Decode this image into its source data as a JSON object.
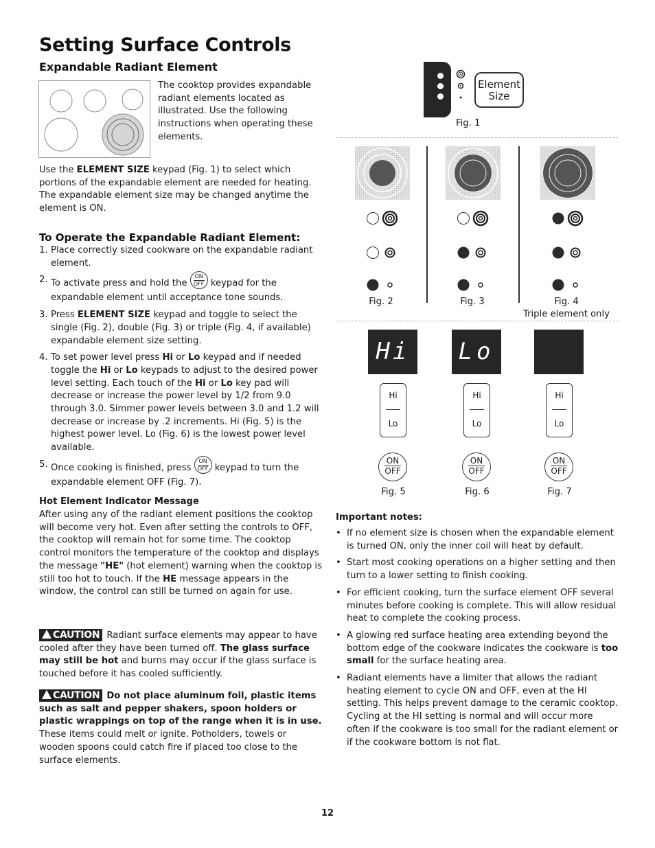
{
  "page": {
    "title": "Setting Surface Controls",
    "subtitle": "Expandable Radiant Element",
    "page_number": "12"
  },
  "intro": {
    "text": "The cooktop provides expandable radiant elements located as illustrated. Use the following instructions when operating these elements.",
    "para_pre": "Use the ",
    "para_bold": "ELEMENT SIZE",
    "para_post": " keypad (Fig. 1) to select which portions of the expandable element are needed for heating. The expandable element size may be changed anytime the element is ON."
  },
  "operate": {
    "heading": "To Operate the Expandable Radiant Element:",
    "steps": [
      {
        "num": "1.",
        "text": "Place correctly sized cookware on the expandable radiant element."
      },
      {
        "num": "2.",
        "pre": "To activate press and hold the ",
        "post": " keypad for the expandable element until acceptance tone sounds."
      },
      {
        "num": "3.",
        "pre": "Press ",
        "bold": "ELEMENT SIZE",
        "post": " keypad and toggle to select the single (Fig. 2), double (Fig. 3) or triple (Fig. 4, if available) expandable element size setting."
      },
      {
        "num": "4.",
        "p1": "To set power level press ",
        "b1": "Hi",
        "p2": " or ",
        "b2": "Lo",
        "p3": " keypad and if needed toggle the ",
        "b3": "Hi",
        "p4": " or ",
        "b4": "Lo",
        "p5": " keypads to adjust to the desired power level setting. Each touch of the ",
        "b5": "Hi",
        "p6": " or ",
        "b6": "Lo",
        "p7": " key pad will decrease or increase the power level by 1/2 from 9.0 through 3.0. Simmer power levels between 3.0 and 1.2 will decrease or increase by .2 increments. Hi (Fig. 5) is the highest power level. Lo (Fig. 6) is the lowest power level available."
      },
      {
        "num": "5.",
        "pre": "Once cooking is finished, press ",
        "post": " keypad to turn the expandable element OFF (Fig. 7)."
      }
    ]
  },
  "onoff": {
    "on": "ON",
    "off": "OFF"
  },
  "hot_indicator": {
    "heading": "Hot Element Indicator Message",
    "p1": "After using any of the radiant element positions the cooktop will become very hot. Even after setting the controls to OFF, the cooktop will remain hot for some time. The cooktop control monitors the temperature of the cooktop and displays the message ",
    "b1": "\"HE\"",
    "p2": " (hot element) warning when the cooktop is still too hot to touch. If the ",
    "b2": "HE",
    "p3": " message appears in the window, the control can still be turned on again for use."
  },
  "cautions": [
    {
      "label": "CAUTION",
      "p1": "Radiant surface elements may appear to have cooled after they have been turned off. ",
      "b1": "The glass surface may still be hot",
      "p2": " and burns may occur if the glass surface is touched before it has cooled sufficiently."
    },
    {
      "label": "CAUTION",
      "b1": "Do not place aluminum foil, plastic items such as salt and pepper shakers, spoon holders or plastic wrappings on top of the range when it is in use.",
      "p2": " These items could melt or ignite. Potholders, towels or wooden spoons could catch fire if placed too close to the surface elements."
    }
  ],
  "figures": {
    "fig1": {
      "label": "Fig. 1",
      "key_line1": "Element",
      "key_line2": "Size"
    },
    "fig2": {
      "label": "Fig. 2"
    },
    "fig3": {
      "label": "Fig. 3"
    },
    "fig4": {
      "label": "Fig. 4",
      "note": "Triple element only"
    },
    "fig5": {
      "label": "Fig. 5",
      "display": "Hi"
    },
    "fig6": {
      "label": "Fig. 6",
      "display": "Lo"
    },
    "fig7": {
      "label": "Fig. 7",
      "display": ""
    },
    "hi_key": "Hi",
    "lo_key": "Lo"
  },
  "notes": {
    "heading": "Important notes:",
    "items": [
      {
        "text": "If no element size is chosen when the expandable element is turned ON, only the inner coil will heat by default."
      },
      {
        "text": "Start most cooking operations on a higher setting and then turn to a lower setting to finish cooking."
      },
      {
        "text": "For efficient cooking, turn the surface element OFF several minutes before cooking is complete. This will allow residual heat to complete the cooking process."
      },
      {
        "pre": "A glowing red surface heating area extending beyond the bottom edge of the cookware indicates the cookware is ",
        "bold": "too small",
        "post": " for the surface heating area."
      },
      {
        "text": "Radiant elements have a limiter that allows the radiant heating element to cycle ON and OFF, even at the HI setting. This helps prevent damage to the ceramic cooktop. Cycling at the HI setting is normal and will occur more often if the cookware is too small for the radiant element or if the cookware bottom is not flat."
      }
    ]
  },
  "colors": {
    "text": "#1a1a1a",
    "panel": "#262626",
    "hatch": "#d8d8d8"
  }
}
